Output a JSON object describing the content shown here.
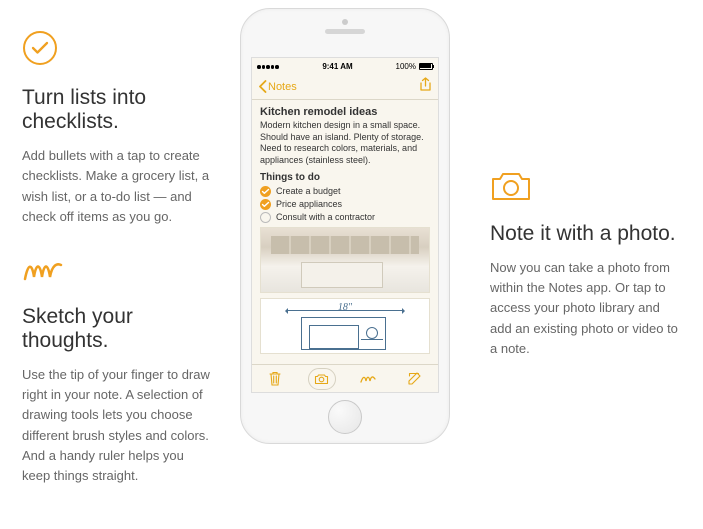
{
  "features": {
    "checklist": {
      "title": "Turn lists into checklists.",
      "body": "Add bullets with a tap to create checklists. Make a grocery list, a wish list, or a to-do list — and check off items as you go."
    },
    "sketch": {
      "title": "Sketch your thoughts.",
      "body": "Use the tip of your finger to draw right in your note. A selection of drawing tools lets you choose different brush styles and colors. And a handy ruler helps you keep things straight."
    },
    "photo": {
      "title": "Note it with a photo.",
      "body": "Now you can take a photo from within the Notes app. Or tap to access your photo library and add an existing photo or video to a note."
    }
  },
  "phone": {
    "status": {
      "time": "9:41 AM",
      "battery": "100%"
    },
    "nav": {
      "back_label": "Notes"
    },
    "note": {
      "title": "Kitchen remodel ideas",
      "description": "Modern kitchen design in a small space. Should have an island. Plenty of storage. Need to research colors, materials, and appliances (stainless steel).",
      "section": "Things to do",
      "items": [
        {
          "label": "Create a budget",
          "checked": true
        },
        {
          "label": "Price appliances",
          "checked": true
        },
        {
          "label": "Consult with a contractor",
          "checked": false
        }
      ],
      "sketch_dim": "18\""
    }
  }
}
